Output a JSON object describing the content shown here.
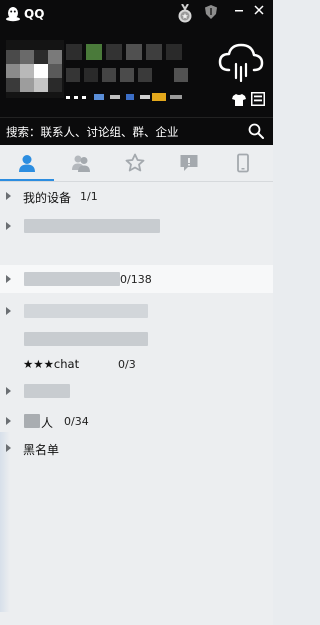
{
  "app": {
    "title": "QQ"
  },
  "search": {
    "label": "搜索：联系人、讨论组、群、企业"
  },
  "tabs": [
    {
      "name": "contacts",
      "icon": "contacts-icon"
    },
    {
      "name": "friends",
      "icon": "friends-icon"
    },
    {
      "name": "favorites",
      "icon": "star-icon"
    },
    {
      "name": "messages",
      "icon": "chat-bubble-icon"
    },
    {
      "name": "mobile",
      "icon": "phone-icon"
    }
  ],
  "groups": [
    {
      "name": "我的设备",
      "count": "1/1"
    },
    {
      "name": "",
      "count": ""
    },
    {
      "name": "",
      "count": "0/138"
    },
    {
      "name": "",
      "count": ""
    },
    {
      "name": "",
      "count": ""
    },
    {
      "name": "★★★chat",
      "count": "0/3"
    },
    {
      "name": "",
      "count": ""
    },
    {
      "name": "人",
      "count": "0/34"
    },
    {
      "name": "黑名单",
      "count": ""
    }
  ],
  "colors": {
    "header_bg": "#0b0b0c",
    "list_bg": "#eceef0",
    "accent": "#2c8de0"
  }
}
